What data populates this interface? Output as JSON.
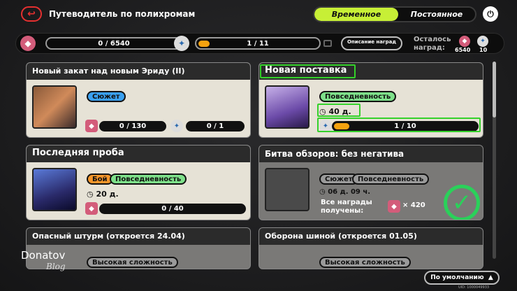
{
  "header": {
    "back_icon": "back-arrow-icon",
    "title": "Путеводитель по полихромам",
    "tab_active": "Временное",
    "tab_inactive": "Постоянное",
    "power_icon": "power-icon"
  },
  "progress": {
    "points": "0 / 6540",
    "tasks": "1 / 11",
    "tasks_fraction": 0.09,
    "desc_button": "Описание наград",
    "remaining_label": "Осталось наград:",
    "remaining_polychrome": "6540",
    "remaining_tickets": "10"
  },
  "cards": [
    {
      "title": "Новый закат над новым Эриду (II)",
      "tags": [
        "Сюжет"
      ],
      "bar1": "0 / 130",
      "bar2": "0 / 1"
    },
    {
      "title": "Новая поставка",
      "tags": [
        "Повседневность"
      ],
      "timer": "40 д.",
      "bar": "1 / 10",
      "fill_fraction": 0.1
    },
    {
      "title": "Последняя проба",
      "tags": [
        "Бой",
        "Повседневность"
      ],
      "timer": "20 д.",
      "bar": "0 / 40"
    },
    {
      "title": "Битва обзоров: без негатива",
      "tags": [
        "Сюжет",
        "Повседневность"
      ],
      "timer": "06 д. 09 ч.",
      "note": "Все награды получены:",
      "reward": "× 420"
    },
    {
      "title": "Опасный штурм (откроется 24.04)",
      "tags": [
        "Высокая сложность"
      ]
    },
    {
      "title": "Оборона шиной (откроется 01.05)",
      "tags": [
        "Высокая сложность"
      ]
    }
  ],
  "sort_label": "По умолчанию",
  "uid": "UID: 1000049933",
  "watermark": {
    "line1": "Donatov",
    "line2": "Blog"
  },
  "colors": {
    "accent": "#c7ef36",
    "highlight": "#34d12a",
    "progress": "#f5a20f",
    "tag_blue": "#3aa0f0",
    "tag_green": "#7ee08a",
    "tag_orange": "#f5962a"
  }
}
